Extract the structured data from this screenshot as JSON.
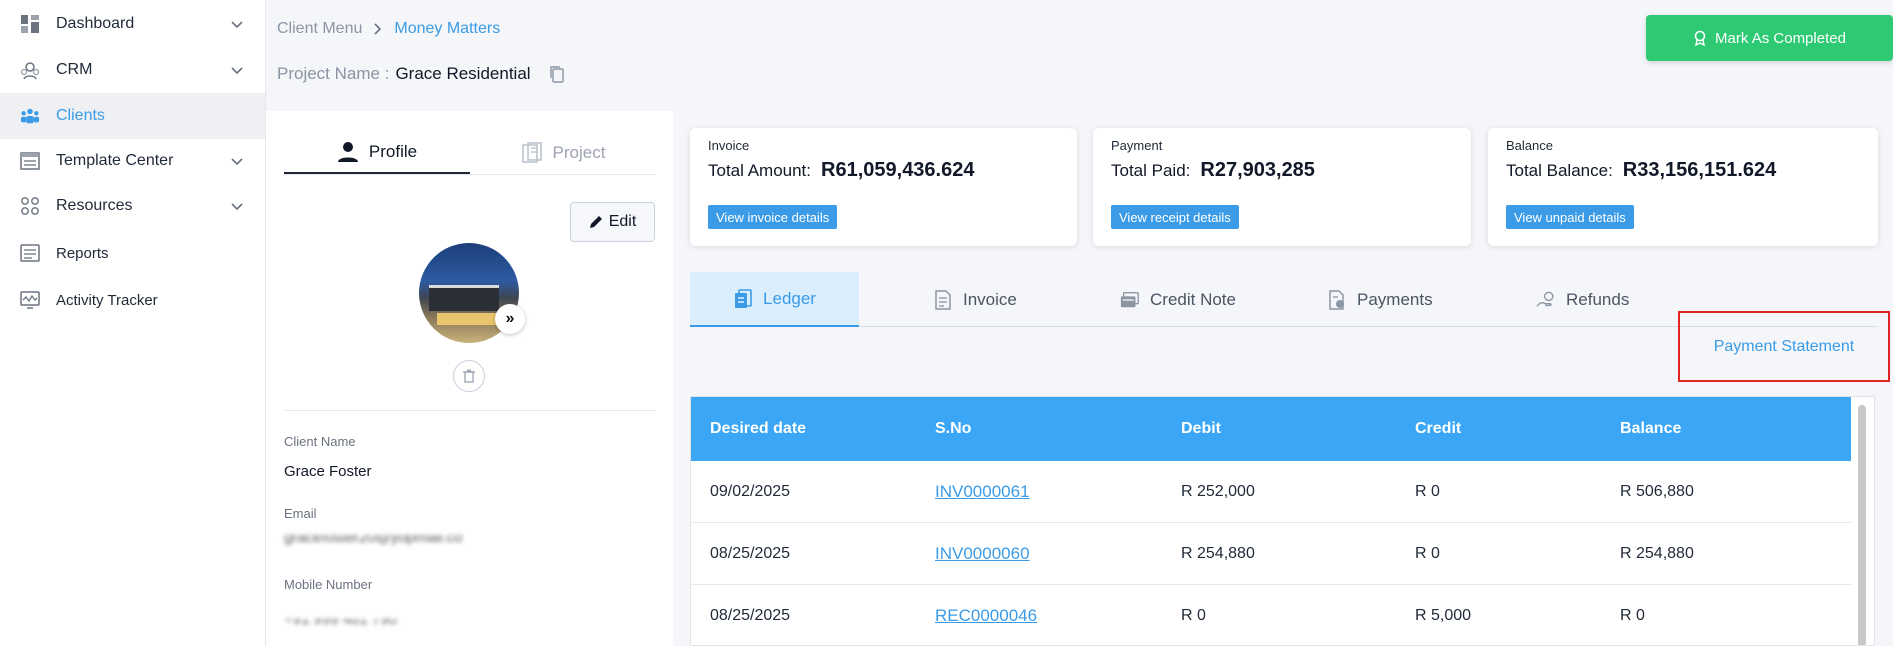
{
  "sidebar": {
    "items": [
      {
        "label": "Dashboard",
        "icon": "dashboard-icon",
        "has_chevron": true
      },
      {
        "label": "CRM",
        "icon": "crm-icon",
        "has_chevron": true
      },
      {
        "label": "Clients",
        "icon": "clients-icon",
        "active": true
      },
      {
        "label": "Template Center",
        "icon": "template-icon",
        "has_chevron": true
      },
      {
        "label": "Resources",
        "icon": "resources-icon",
        "has_chevron": true
      },
      {
        "label": "Reports",
        "icon": "reports-icon"
      },
      {
        "label": "Activity Tracker",
        "icon": "activity-icon"
      }
    ]
  },
  "breadcrumb": {
    "parent": "Client Menu",
    "current": "Money Matters"
  },
  "project": {
    "label": "Project Name :",
    "name": "Grace Residential"
  },
  "mark_completed_label": "Mark As Completed",
  "profile_panel": {
    "tabs": [
      {
        "label": "Profile"
      },
      {
        "label": "Project"
      }
    ],
    "edit_label": "Edit",
    "fields": {
      "client_name_label": "Client Name",
      "client_name": "Grace Foster",
      "email_label": "Email",
      "email": "gracefoster20@yopmail.co",
      "mobile_label": "Mobile Number",
      "mobile": "+91 999 481 790"
    }
  },
  "cards": [
    {
      "title": "Invoice",
      "line_label": "Total Amount:",
      "amount": "R61,059,436.624",
      "button": "View invoice details"
    },
    {
      "title": "Payment",
      "line_label": "Total Paid:",
      "amount": "R27,903,285",
      "button": "View receipt details"
    },
    {
      "title": "Balance",
      "line_label": "Total Balance:",
      "amount": "R33,156,151.624",
      "button": "View unpaid details"
    }
  ],
  "ledger_tabs": [
    {
      "label": "Ledger",
      "active": true
    },
    {
      "label": "Invoice"
    },
    {
      "label": "Credit Note"
    },
    {
      "label": "Payments"
    },
    {
      "label": "Refunds"
    }
  ],
  "payment_statement_label": "Payment Statement",
  "table": {
    "headers": [
      "Desired date",
      "S.No",
      "Debit",
      "Credit",
      "Balance"
    ],
    "rows": [
      [
        "09/02/2025",
        "INV0000061",
        "R 252,000",
        "R 0",
        "R 506,880"
      ],
      [
        "08/25/2025",
        "INV0000060",
        "R 254,880",
        "R 0",
        "R 254,880"
      ],
      [
        "08/25/2025",
        "REC0000046",
        "R 0",
        "R 5,000",
        "R 0"
      ]
    ]
  },
  "colors": {
    "accent": "#3b9be6",
    "success": "#2dca73",
    "table_header": "#3aa6f5",
    "highlight_border": "#e02424"
  }
}
